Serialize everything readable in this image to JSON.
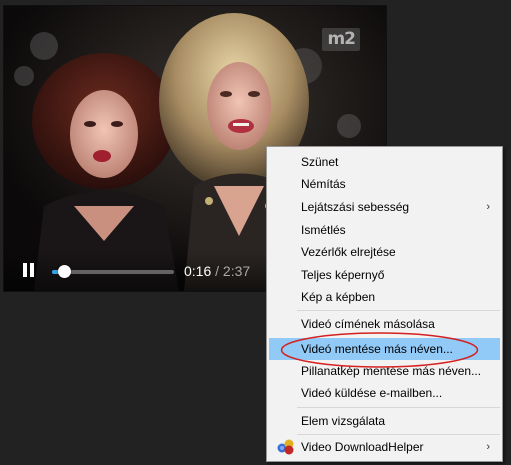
{
  "player": {
    "channel_logo": "m2",
    "current_time": "0:16",
    "separator": "/",
    "duration": "2:37",
    "progress": 0.1
  },
  "context_menu": {
    "items": [
      {
        "label": "Szünet"
      },
      {
        "label": "Némítás"
      },
      {
        "label": "Lejátszási sebesség",
        "submenu": true
      },
      {
        "label": "Ismétlés"
      },
      {
        "label": "Vezérlők elrejtése"
      },
      {
        "label": "Teljes képernyő"
      },
      {
        "label": "Kép a képben"
      },
      {
        "label": "Videó címének másolása"
      },
      {
        "label": "Videó mentése más néven...",
        "highlighted": true
      },
      {
        "label": "Pillanatkép mentése más néven..."
      },
      {
        "label": "Videó küldése e-mailben..."
      },
      {
        "label": "Elem vizsgálata"
      },
      {
        "label": "Video DownloadHelper",
        "submenu": true,
        "icon": "video-downloadhelper-icon"
      }
    ],
    "submenu_arrow": "›"
  },
  "colors": {
    "page_background": "#222222",
    "menu_background": "#f2f2f2",
    "menu_highlight": "#91c9f7",
    "scrubber_fill": "#30a4e6",
    "annotation": "#d42020"
  }
}
